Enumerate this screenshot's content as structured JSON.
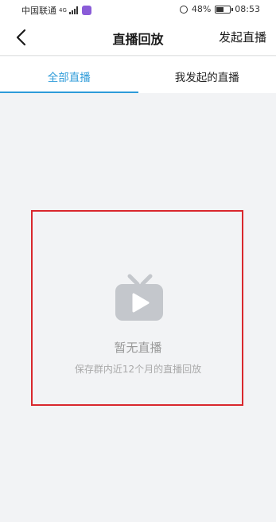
{
  "statusbar": {
    "carrier": "中国联通",
    "network": "4G",
    "battery": "48%",
    "time": "08:53"
  },
  "navbar": {
    "title": "直播回放",
    "action": "发起直播"
  },
  "tabs": [
    {
      "label": "全部直播",
      "active": true
    },
    {
      "label": "我发起的直播",
      "active": false
    }
  ],
  "empty_state": {
    "title": "暂无直播",
    "subtitle": "保存群内近12个月的直播回放"
  },
  "colors": {
    "accent": "#2d9bd9",
    "highlight_box": "#d9272d"
  }
}
